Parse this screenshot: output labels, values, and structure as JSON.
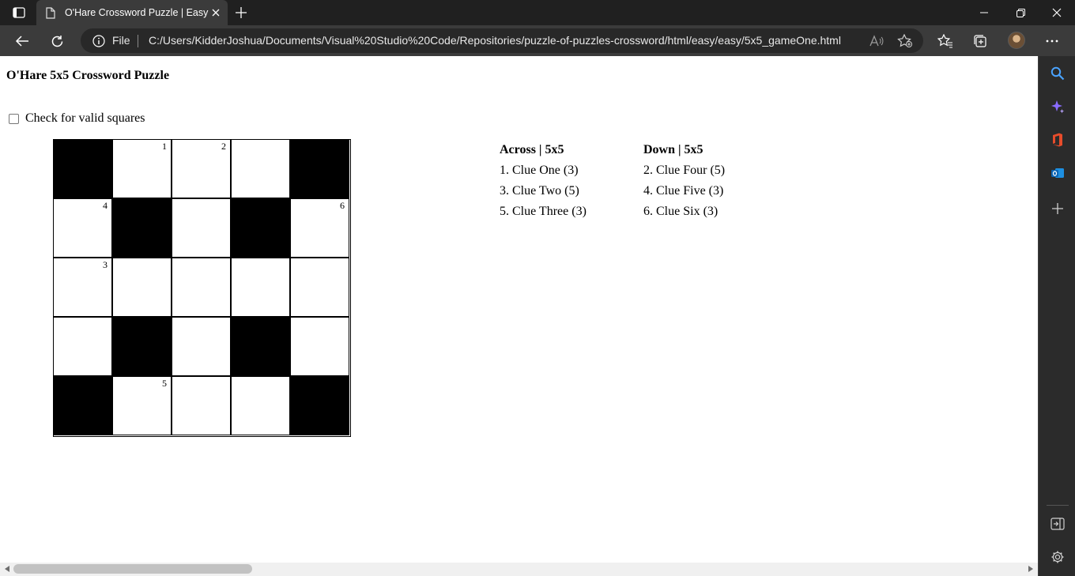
{
  "browser": {
    "tab": {
      "title": "O'Hare Crossword Puzzle | Easy"
    },
    "address": {
      "scheme_label": "File",
      "url": "C:/Users/KidderJoshua/Documents/Visual%20Studio%20Code/Repositories/puzzle-of-puzzles-crossword/html/easy/easy/5x5_gameOne.html"
    },
    "read_aloud_label": "A̅"
  },
  "page": {
    "heading": "O'Hare 5x5 Crossword Puzzle",
    "checkbox": {
      "label": "Check for valid squares",
      "checked": false
    },
    "grid": {
      "size": 5,
      "rows": [
        [
          {
            "black": true
          },
          {
            "number": "1"
          },
          {
            "number": "2"
          },
          {},
          {
            "black": true
          }
        ],
        [
          {
            "number": "4"
          },
          {
            "black": true
          },
          {},
          {
            "black": true
          },
          {
            "number": "6"
          }
        ],
        [
          {
            "number": "3"
          },
          {},
          {},
          {},
          {}
        ],
        [
          {},
          {
            "black": true
          },
          {},
          {
            "black": true
          },
          {}
        ],
        [
          {
            "black": true
          },
          {
            "number": "5"
          },
          {},
          {},
          {
            "black": true
          }
        ]
      ]
    },
    "across": {
      "heading": "Across | 5x5",
      "clues": [
        "1. Clue One (3)",
        "3. Clue Two (5)",
        "5. Clue Three (3)"
      ]
    },
    "down": {
      "heading": "Down | 5x5",
      "clues": [
        "2. Clue Four (5)",
        "4. Clue Five (3)",
        "6. Clue Six (3)"
      ]
    }
  },
  "colors": {
    "chrome_dark": "#202020",
    "toolbar": "#3b3b3b",
    "accent_blue": "#4aa3ff",
    "copilot_purple": "#8a6cff",
    "office_red": "#e74c2b",
    "outlook_blue": "#1d8fe1"
  },
  "icons": {
    "sidebar": [
      "search-icon",
      "copilot-icon",
      "office-icon",
      "outlook-icon",
      "add-icon",
      "hide-sidebar-icon",
      "settings-icon"
    ]
  }
}
